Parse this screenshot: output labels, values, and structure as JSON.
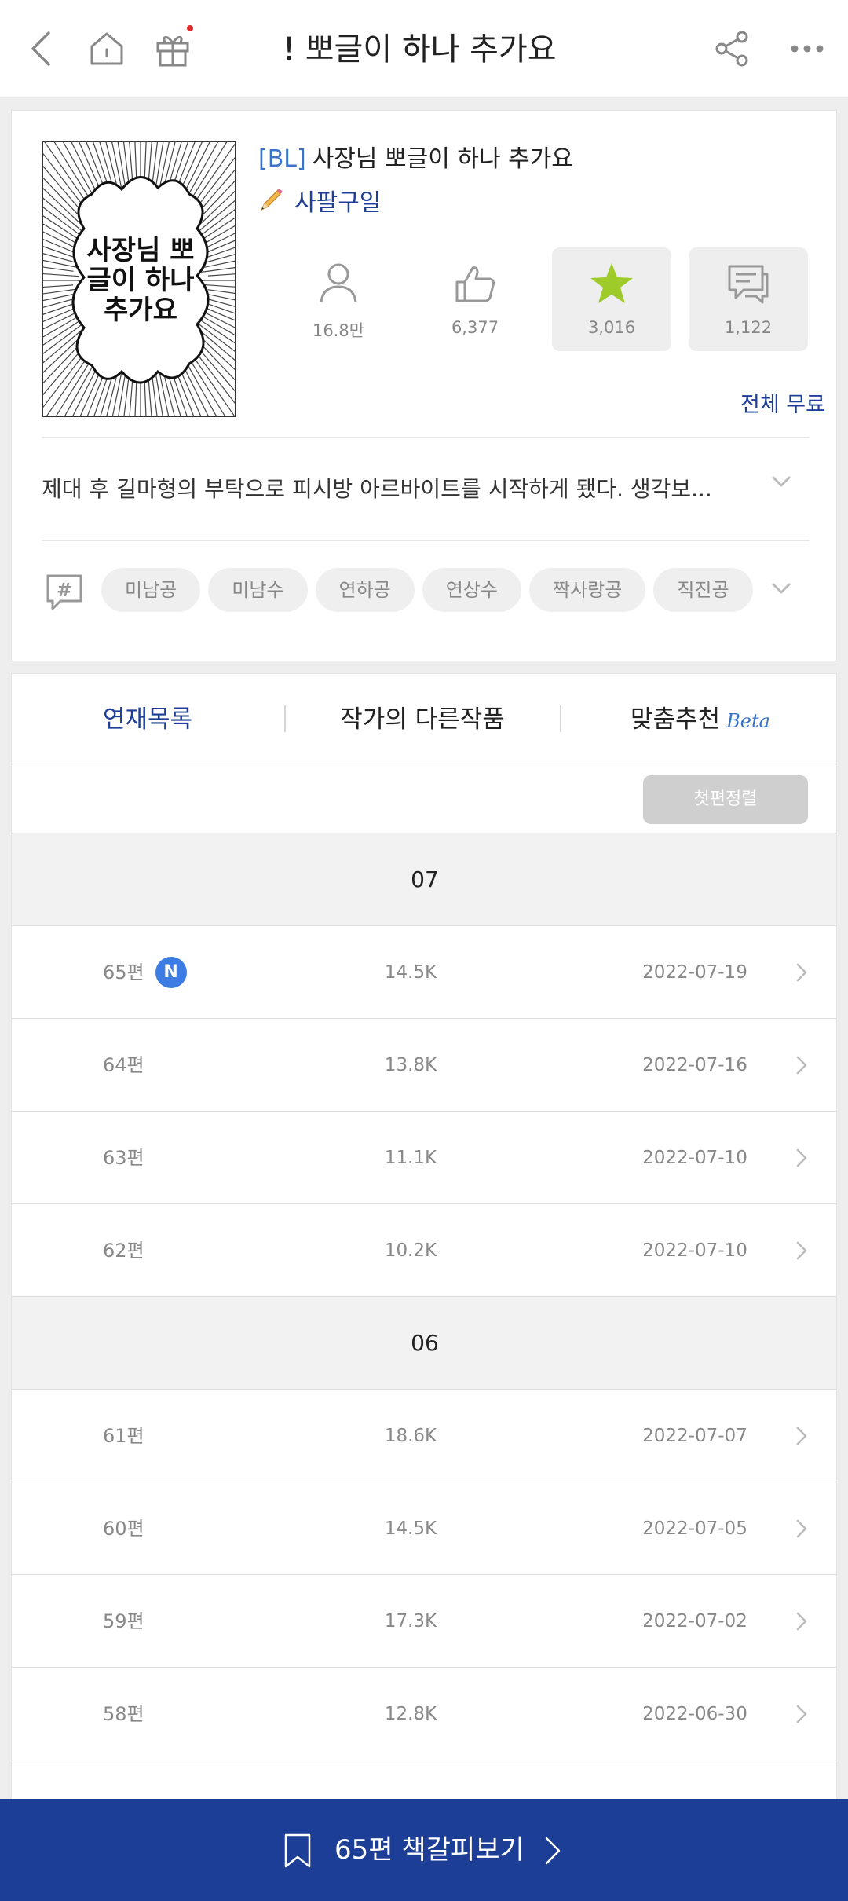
{
  "header": {
    "title": "! 뽀글이 하나 추가요",
    "icons": [
      "back-icon",
      "home-icon",
      "gift-icon",
      "share-icon",
      "more-icon"
    ]
  },
  "work": {
    "cover_text": "사장님 뽀글이 하나 추가요",
    "genre": "[BL]",
    "title": "사장님 뽀글이 하나 추가요",
    "author": "사팔구일",
    "stats": {
      "views": "16.8만",
      "likes": "6,377",
      "rating": "3,016",
      "comments": "1,122"
    },
    "price_label": "전체 무료",
    "synopsis": "제대 후 길마형의 부탁으로 피시방 아르바이트를 시작하게 됐다. 생각보...",
    "tags": [
      "미남공",
      "미남수",
      "연하공",
      "연상수",
      "짝사랑공",
      "직진공"
    ]
  },
  "tabs": [
    {
      "label": "연재목록",
      "active": true
    },
    {
      "label": "작가의 다른작품",
      "active": false
    },
    {
      "label": "맞춤추천",
      "badge": "Beta",
      "active": false
    }
  ],
  "list": {
    "sort_label": "첫편정렬",
    "groups": [
      {
        "month": "07",
        "rows": [
          {
            "episode": "65편",
            "is_new": true,
            "new_badge": "N",
            "views": "14.5K",
            "date": "2022-07-19"
          },
          {
            "episode": "64편",
            "views": "13.8K",
            "date": "2022-07-16"
          },
          {
            "episode": "63편",
            "views": "11.1K",
            "date": "2022-07-10"
          },
          {
            "episode": "62편",
            "views": "10.2K",
            "date": "2022-07-10"
          }
        ]
      },
      {
        "month": "06",
        "rows": [
          {
            "episode": "61편",
            "views": "18.6K",
            "date": "2022-07-07"
          },
          {
            "episode": "60편",
            "views": "14.5K",
            "date": "2022-07-05"
          },
          {
            "episode": "59편",
            "views": "17.3K",
            "date": "2022-07-02"
          },
          {
            "episode": "58편",
            "views": "12.8K",
            "date": "2022-06-30"
          }
        ]
      }
    ]
  },
  "bottom_bar": {
    "label": "65편 책갈피보기"
  },
  "colors": {
    "brand_navy": "#1d3e97",
    "accent_blue": "#3a74c9",
    "star_green": "#9fcb2a",
    "new_badge_blue": "#3d7de3"
  }
}
